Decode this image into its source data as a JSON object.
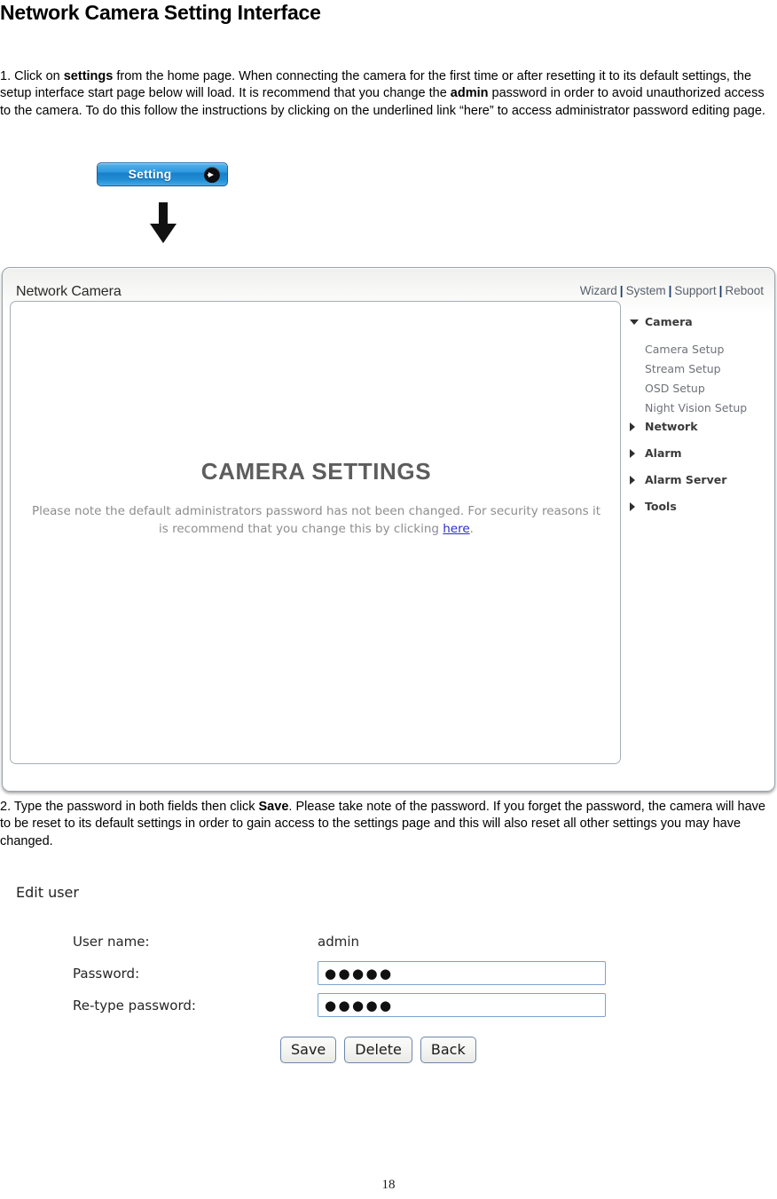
{
  "document": {
    "title": "Network Camera Setting Interface",
    "page_number": "18",
    "paragraph_1": {
      "part_a": "1. Click on ",
      "bold_a": "settings",
      "part_b": " from the home page. When connecting the camera for the first time or after resetting it to its default settings, the setup interface start page below will load. It is recommend that you change the ",
      "bold_b": "admin",
      "part_c": " password in order to avoid unauthorized access to the camera. To do this follow the instructions by clicking on the underlined link “here” to access administrator password editing page."
    },
    "paragraph_2": {
      "part_a": "2. Type the password in both fields then click ",
      "bold_a": "Save",
      "part_b": ". Please take note of the password. If you forget the password, the camera will have to be reset to its default settings in order to gain access to the settings page and this will also reset all other settings you may have changed."
    }
  },
  "setting_button": {
    "label": "Setting",
    "arrow_icon": "arrow-right-circle-icon",
    "gradient_top": "#58b2ea",
    "gradient_mid": "#1b7fc9",
    "border_color": "#1d5f9e",
    "text_color": "#ffffff"
  },
  "down_arrow": {
    "icon": "arrow-down-icon",
    "color": "#0d0d0d"
  },
  "camera_ui": {
    "brand": "Network Camera",
    "nav_links": [
      {
        "label": "Wizard"
      },
      {
        "label": "System"
      },
      {
        "label": "Support"
      },
      {
        "label": "Reboot"
      }
    ],
    "nav_separator": "|",
    "main": {
      "heading": "CAMERA SETTINGS",
      "note_part_a": "Please note the default administrators password has not been changed. For security reasons it is recommend that you change this by clicking ",
      "note_link": "here",
      "note_part_b": ".",
      "heading_color": "#5d5d5d",
      "note_color": "#8e8e8e",
      "link_color": "#2a2ad0"
    },
    "menu": [
      {
        "label": "Camera",
        "expanded": true,
        "icon": "triangle-down-icon",
        "children": [
          {
            "label": "Camera Setup"
          },
          {
            "label": "Stream Setup"
          },
          {
            "label": "OSD Setup"
          },
          {
            "label": "Night Vision Setup"
          }
        ]
      },
      {
        "label": "Network",
        "expanded": false,
        "icon": "triangle-right-icon",
        "children": []
      },
      {
        "label": "Alarm",
        "expanded": false,
        "icon": "triangle-right-icon",
        "children": []
      },
      {
        "label": "Alarm Server",
        "expanded": false,
        "icon": "triangle-right-icon",
        "children": []
      },
      {
        "label": "Tools",
        "expanded": false,
        "icon": "triangle-right-icon",
        "children": []
      }
    ]
  },
  "edit_user": {
    "title": "Edit user",
    "rows": [
      {
        "label": "User name:",
        "value": "admin",
        "type": "text"
      },
      {
        "label": "Password:",
        "value": "●●●●●",
        "type": "password"
      },
      {
        "label": "Re-type password:",
        "value": "●●●●●",
        "type": "password"
      }
    ],
    "buttons": [
      {
        "label": "Save"
      },
      {
        "label": "Delete"
      },
      {
        "label": "Back"
      }
    ]
  }
}
